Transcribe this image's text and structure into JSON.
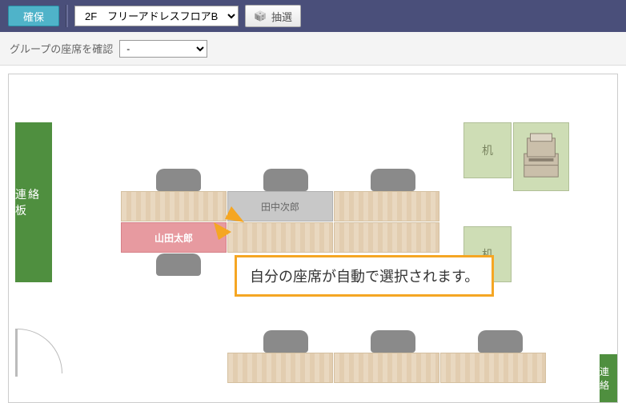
{
  "topbar": {
    "reserve_label": "確保",
    "floor_selected": "2F　フリーアドレスフロアB",
    "lottery_label": "抽選"
  },
  "subbar": {
    "group_label": "グループの座席を確認",
    "group_selected": "-"
  },
  "layout": {
    "board_left": "連絡板",
    "board_right_bottom": "連絡",
    "desk_label_1": "机",
    "desk_label_2": "机",
    "seat_tanaka": "田中次郎",
    "seat_yamada": "山田太郎"
  },
  "callout": {
    "text": "自分の座席が自動で選択されます。"
  },
  "colors": {
    "topbar": "#4a4f7a",
    "reserve": "#4fb3c9",
    "board": "#4f8f3f",
    "accent": "#f5a623",
    "seat_self": "#e79aa0"
  }
}
